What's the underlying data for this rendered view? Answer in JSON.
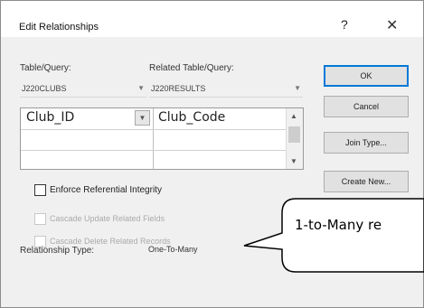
{
  "dialog": {
    "title": "Edit Relationships",
    "help_label": "?",
    "close_label": "✕"
  },
  "table": {
    "label": "Table/Query:",
    "value": "J220CLUBS"
  },
  "related_table": {
    "label": "Related Table/Query:",
    "value": "J220RESULTS"
  },
  "fields": {
    "rows": [
      {
        "left": "Club_ID",
        "right": "Club_Code"
      },
      {
        "left": "",
        "right": ""
      },
      {
        "left": "",
        "right": ""
      }
    ]
  },
  "buttons": {
    "ok": "OK",
    "cancel": "Cancel",
    "join_type": "Join Type...",
    "create_new": "Create New..."
  },
  "options": {
    "enforce": "Enforce Referential Integrity",
    "cascade_update": "Cascade Update Related Fields",
    "cascade_delete": "Cascade Delete Related Records"
  },
  "relationship_type": {
    "label": "Relationship Type:",
    "value": "One-To-Many"
  },
  "callout": {
    "text": "1-to-Many re"
  }
}
